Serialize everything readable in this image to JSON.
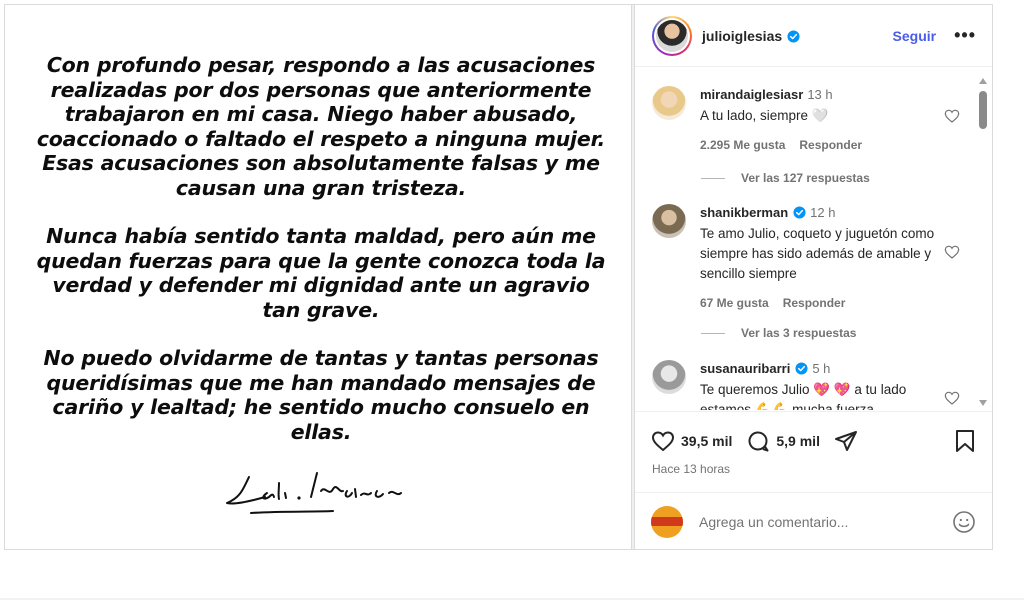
{
  "post": {
    "paragraphs": [
      "Con profundo pesar, respondo a las acusaciones realizadas por dos personas que anteriormente trabajaron en mi casa. Niego haber abusado, coaccionado o faltado el respeto a ninguna mujer. Esas acusaciones son absolutamente falsas y me causan una gran tristeza.",
      "Nunca había sentido tanta maldad, pero aún me quedan fuerzas para que la gente conozca toda la verdad y defender mi dignidad ante un agravio tan grave.",
      "No puedo olvidarme de tantas y tantas personas queridísimas que me han mandado mensajes de cariño y lealtad; he sentido mucho consuelo en ellas."
    ],
    "signature": "Julio Iglesias"
  },
  "header": {
    "username": "julioiglesias",
    "follow_label": "Seguir",
    "more_label": "•••"
  },
  "comments": [
    {
      "username": "mirandaiglesiasr",
      "time": "13 h",
      "text": "A tu lado, siempre 🤍",
      "likes": "2.295 Me gusta",
      "reply_label": "Responder",
      "view_replies": "Ver las 127 respuestas",
      "verified": false
    },
    {
      "username": "shanikberman",
      "time": "12 h",
      "text": "Te amo Julio, coqueto y juguetón como siempre has sido además de amable y sencillo siempre",
      "likes": "67 Me gusta",
      "reply_label": "Responder",
      "view_replies": "Ver las 3 respuestas",
      "verified": true
    },
    {
      "username": "susanauribarri",
      "time": "5 h",
      "text": "Te queremos Julio 💖 💖 a tu lado estamos 💪💪 mucha fuerza",
      "verified": true
    }
  ],
  "actions": {
    "likes_count": "39,5 mil",
    "comments_count": "5,9 mil",
    "posted_ago": "Hace 13 horas"
  },
  "add_comment": {
    "placeholder": "Agrega un comentario..."
  },
  "colors": {
    "accent": "#4a5de8",
    "verified": "#0095f6",
    "muted": "#737373",
    "text": "#262626"
  }
}
